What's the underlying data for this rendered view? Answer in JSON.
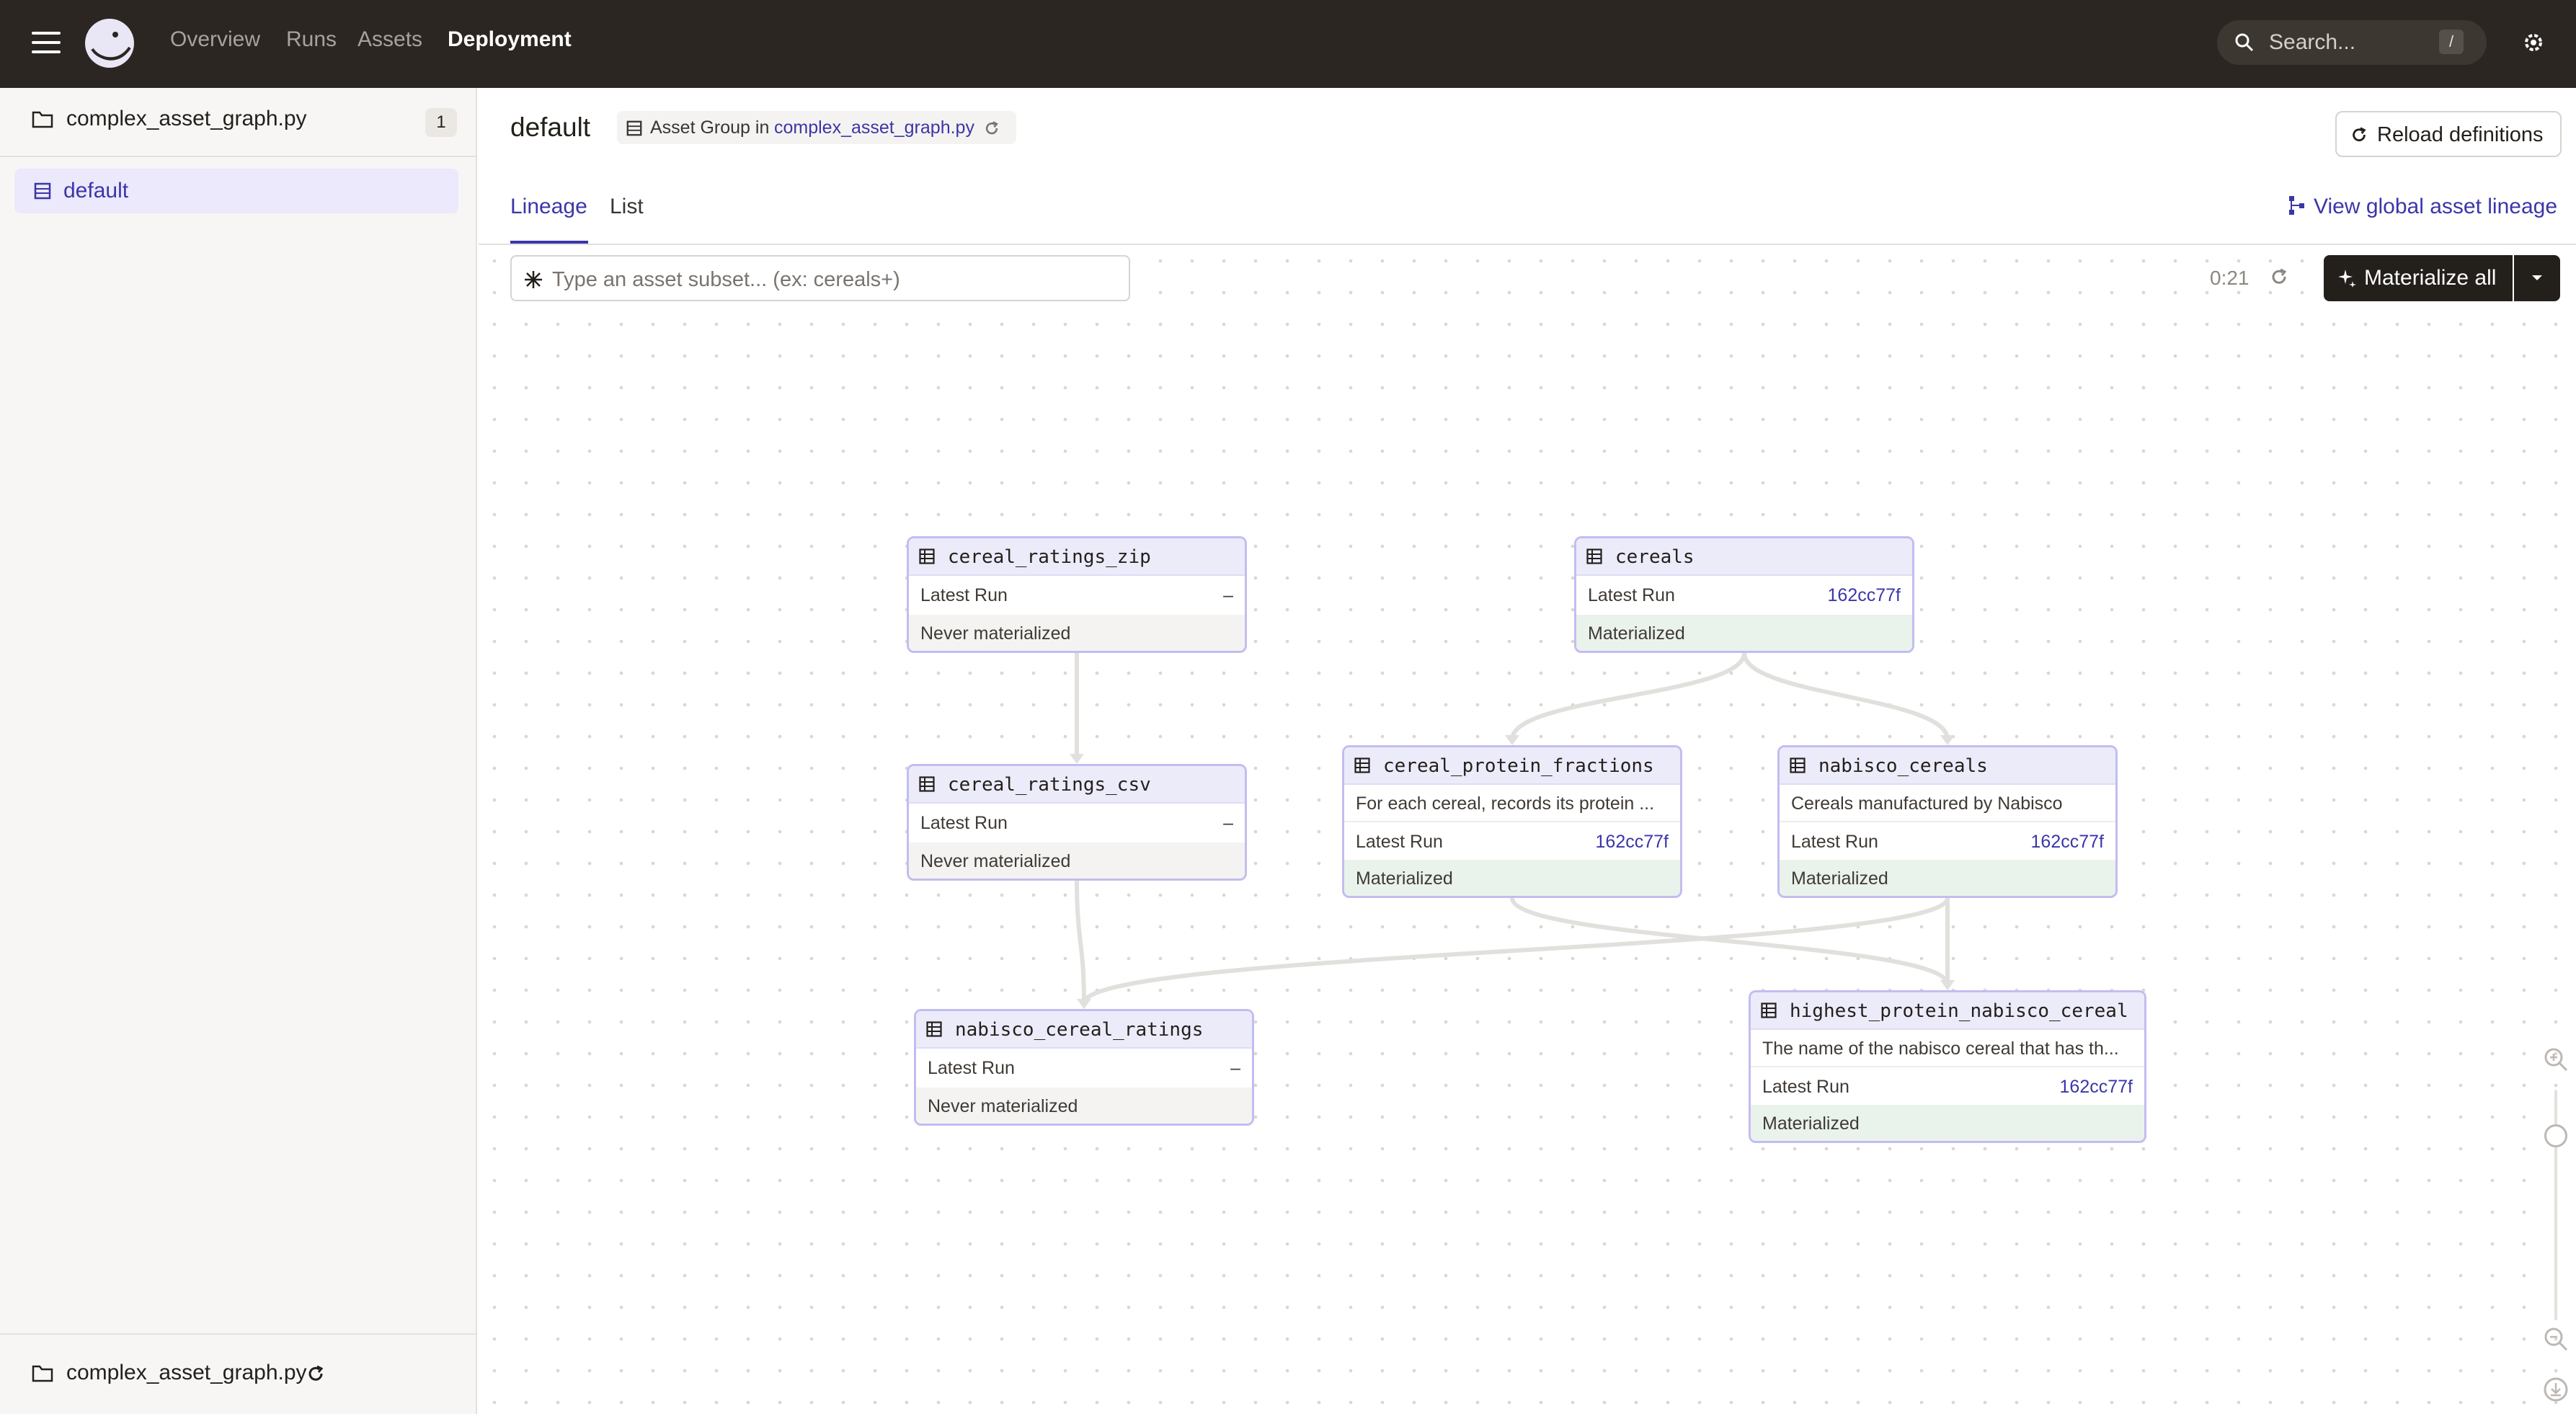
{
  "topnav": {
    "links": [
      "Overview",
      "Runs",
      "Assets",
      "Deployment"
    ],
    "search_placeholder": "Search...",
    "search_shortcut": "/"
  },
  "sidebar": {
    "location_name": "complex_asset_graph.py",
    "location_count": "1",
    "groups": [
      {
        "label": "default"
      }
    ],
    "footer_location": "complex_asset_graph.py"
  },
  "header": {
    "title": "default",
    "tag_prefix": "Asset Group in",
    "tag_link": "complex_asset_graph.py",
    "reload_label": "Reload definitions"
  },
  "tabs": [
    {
      "label": "Lineage",
      "active": true
    },
    {
      "label": "List",
      "active": false
    }
  ],
  "global_lineage_label": "View global asset lineage",
  "toolbar": {
    "filter_placeholder": "Type an asset subset... (ex: cereals+)",
    "refresh_timer": "0:21",
    "materialize_label": "Materialize all"
  },
  "nodes": [
    {
      "name": "cereal_ratings_zip",
      "description": null,
      "latest_run_label": "Latest Run",
      "latest_run": "–",
      "status": "Never materialized"
    },
    {
      "name": "cereals",
      "description": null,
      "latest_run_label": "Latest Run",
      "latest_run": "162cc77f",
      "status": "Materialized"
    },
    {
      "name": "cereal_ratings_csv",
      "description": null,
      "latest_run_label": "Latest Run",
      "latest_run": "–",
      "status": "Never materialized"
    },
    {
      "name": "cereal_protein_fractions",
      "description": "For each cereal, records its protein ...",
      "latest_run_label": "Latest Run",
      "latest_run": "162cc77f",
      "status": "Materialized"
    },
    {
      "name": "nabisco_cereals",
      "description": "Cereals manufactured by Nabisco",
      "latest_run_label": "Latest Run",
      "latest_run": "162cc77f",
      "status": "Materialized"
    },
    {
      "name": "nabisco_cereal_ratings",
      "description": null,
      "latest_run_label": "Latest Run",
      "latest_run": "–",
      "status": "Never materialized"
    },
    {
      "name": "highest_protein_nabisco_cereal",
      "description": "The name of the nabisco cereal that has th...",
      "latest_run_label": "Latest Run",
      "latest_run": "162cc77f",
      "status": "Materialized"
    }
  ],
  "edges": [
    [
      "cereal_ratings_zip",
      "cereal_ratings_csv"
    ],
    [
      "cereal_ratings_csv",
      "nabisco_cereal_ratings"
    ],
    [
      "cereals",
      "cereal_protein_fractions"
    ],
    [
      "cereals",
      "nabisco_cereals"
    ],
    [
      "nabisco_cereals",
      "nabisco_cereal_ratings"
    ],
    [
      "cereal_protein_fractions",
      "highest_protein_nabisco_cereal"
    ],
    [
      "nabisco_cereals",
      "highest_protein_nabisco_cereal"
    ]
  ],
  "colors": {
    "topbar": "#2b2622",
    "accent": "#3b36a8",
    "node_border": "#c2bdf0",
    "node_header": "#ecebfa",
    "materialized": "#eaf2ec",
    "never_materialized": "#f4f3f1"
  }
}
